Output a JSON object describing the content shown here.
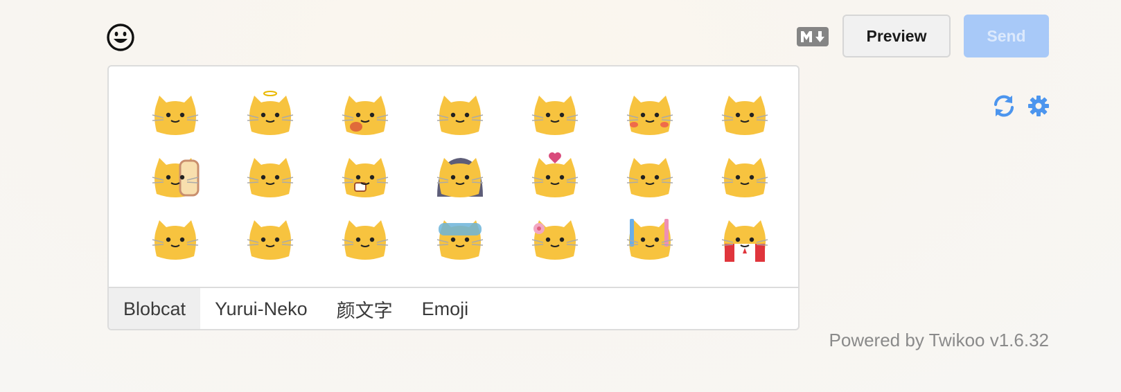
{
  "toolbar": {
    "emoji_icon": "smiley-icon",
    "markdown_icon": "markdown-icon",
    "preview_label": "Preview",
    "send_label": "Send",
    "refresh_icon": "refresh-icon",
    "settings_icon": "gear-icon"
  },
  "emoji_panel": {
    "stickers": [
      "blobcat",
      "blobcat-angel",
      "blobcat-surprised",
      "blobcat-peek",
      "blobcat-hands-up",
      "blobcat-blush",
      "blobcat-angry",
      "blobcat-bread",
      "blobcat-scream",
      "blobcat-coffee",
      "blobcat-hood",
      "blobcat-love",
      "blobcat-cry-laugh",
      "blobcat-dead",
      "blobcat-facepalm",
      "blobcat-drool",
      "blobcat-googly",
      "blobcat-fear",
      "blobcat-flower",
      "blobcat-pencils",
      "blobcat-canada"
    ],
    "tabs": [
      "Blobcat",
      "Yurui-Neko",
      "颜文字",
      "Emoji"
    ],
    "active_tab": "Blobcat"
  },
  "footer": {
    "powered_by": "Powered by Twikoo v1.6.32"
  },
  "colors": {
    "accent": "#4c95ee",
    "send_disabled_bg": "#a8c9f8",
    "blob_yellow": "#f7c33f"
  }
}
